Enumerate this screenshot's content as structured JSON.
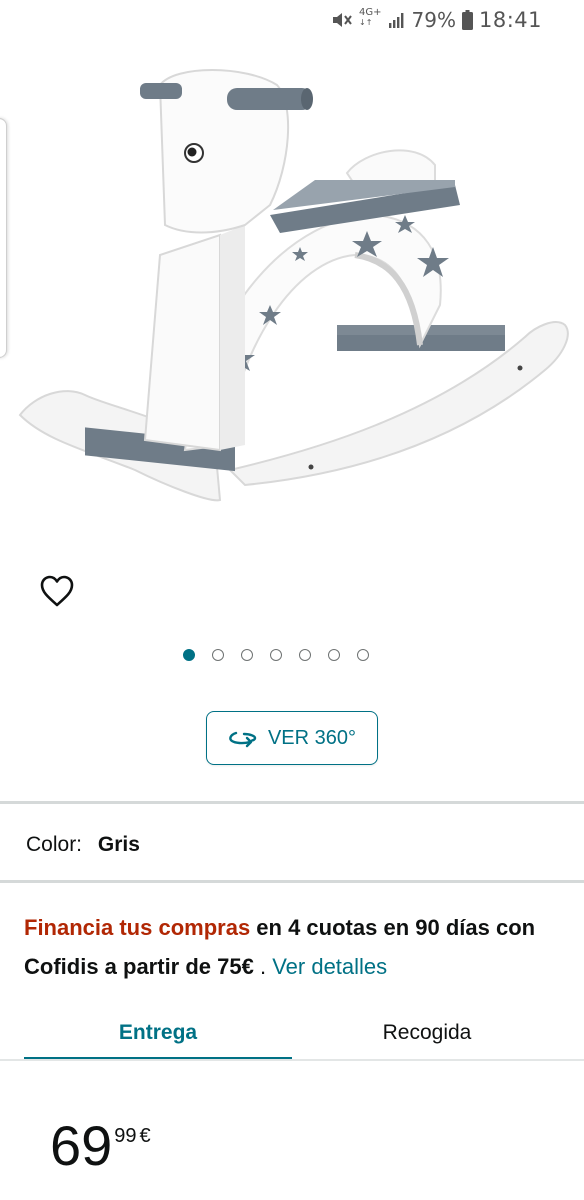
{
  "status_bar": {
    "network": "4G+",
    "battery": "79%",
    "time": "18:41"
  },
  "product": {
    "image_alt": "rocking horse",
    "carousel": {
      "total": 7,
      "active_index": 0
    },
    "view_360_label": "VER 360°"
  },
  "color": {
    "label": "Color:",
    "value": "Gris"
  },
  "financing": {
    "promo": "Financia tus compras",
    "text": " en 4 cuotas en 90 días con Cofidis a partir de 75€",
    "separator": " . ",
    "link": "Ver detalles"
  },
  "delivery_tabs": {
    "entrega": "Entrega",
    "recogida": "Recogida",
    "active": "entrega"
  },
  "price": {
    "whole": "69",
    "fraction": "99",
    "currency": "€"
  },
  "colors": {
    "accent": "#007185",
    "promo": "#b12704",
    "text": "#0f1111"
  },
  "icons": {
    "wishlist": "heart-outline-icon",
    "view_360": "rotate-360-icon"
  }
}
